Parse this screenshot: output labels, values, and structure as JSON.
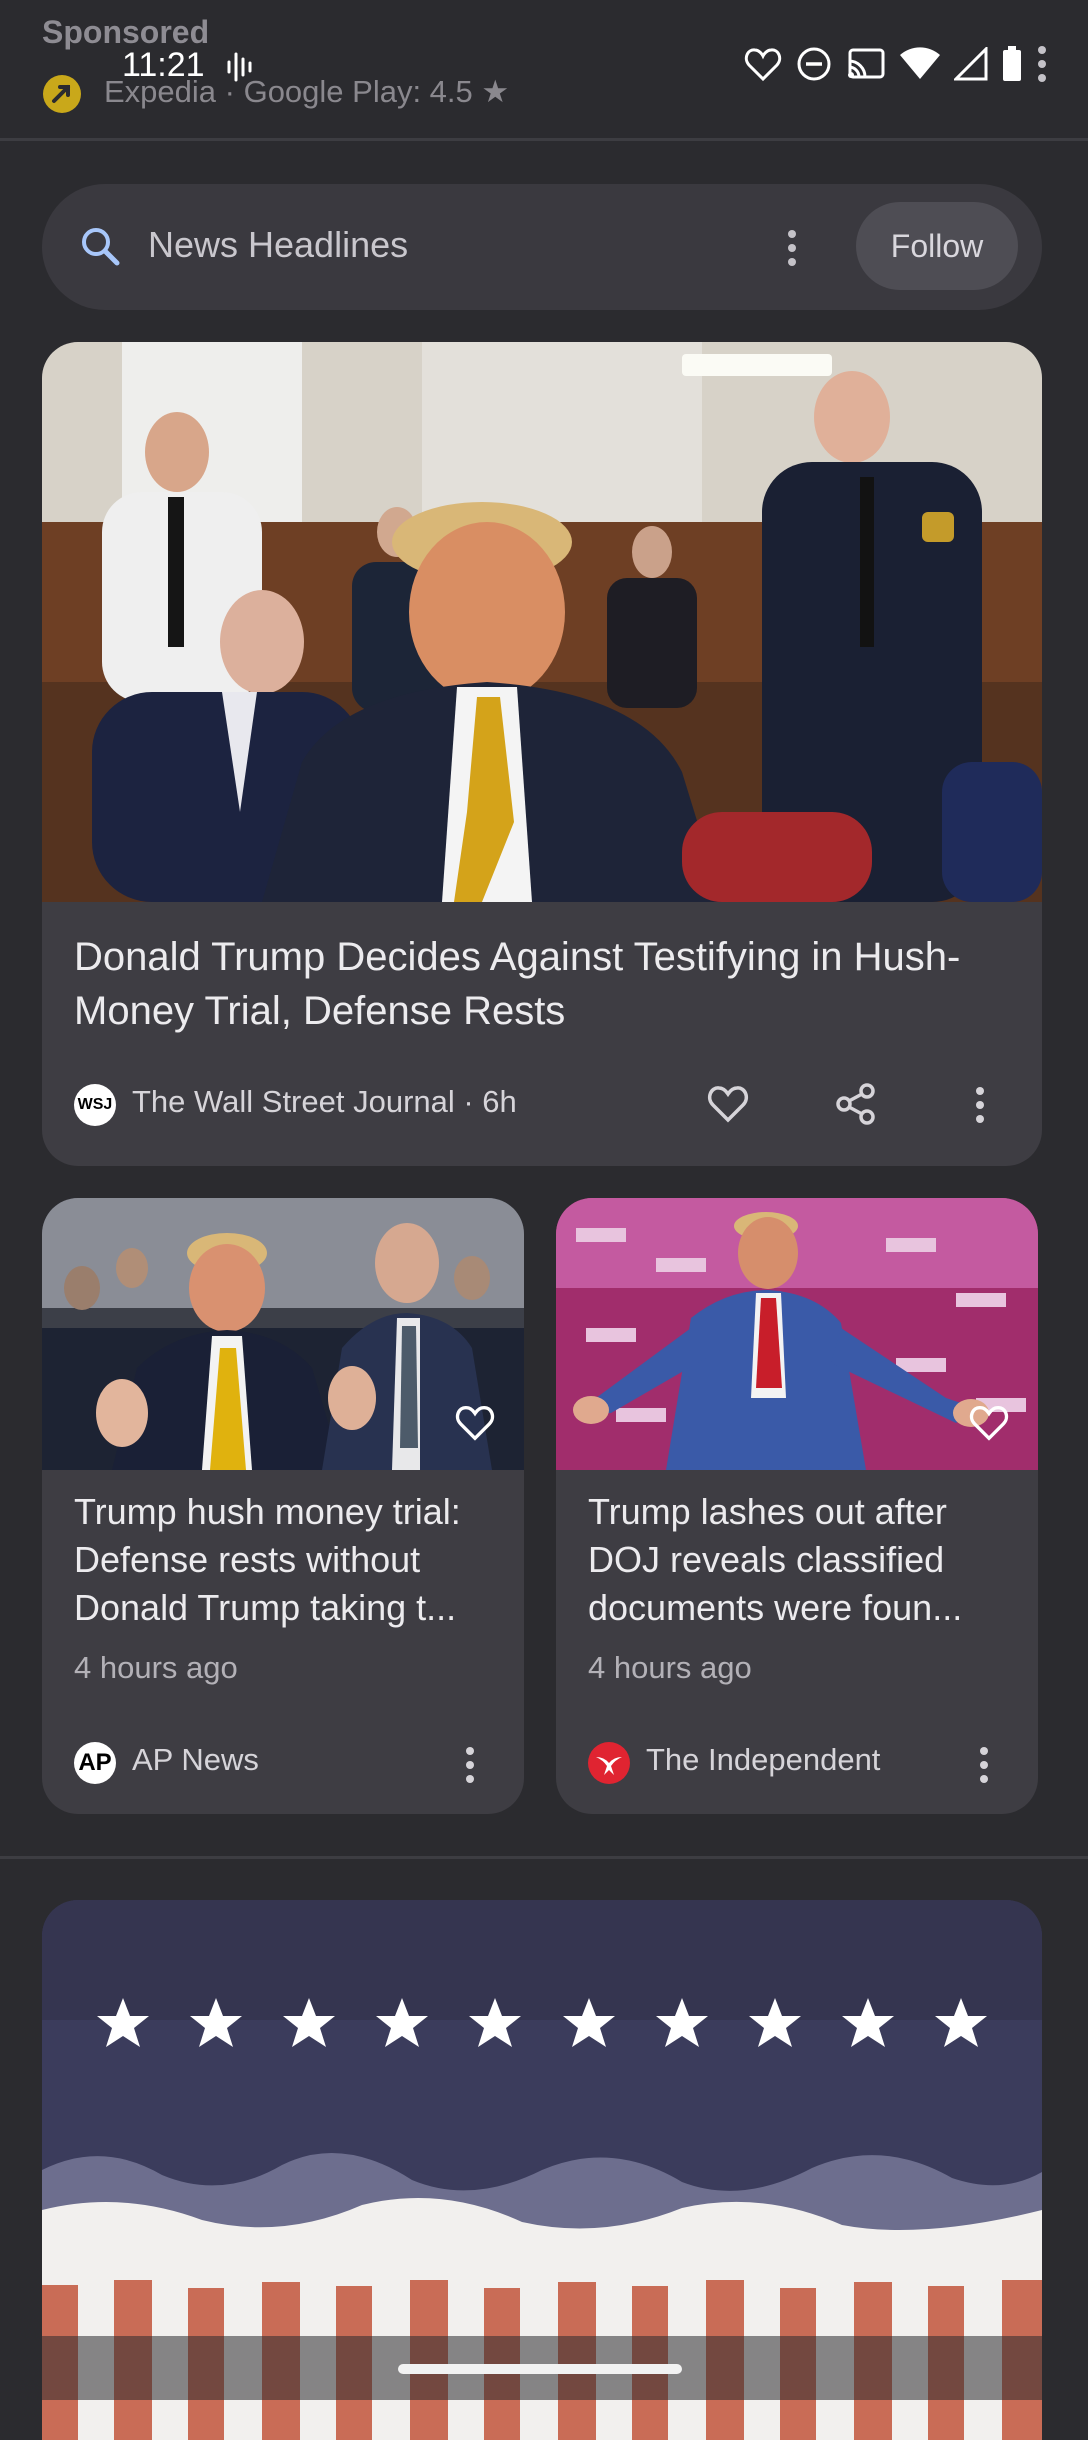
{
  "ad": {
    "sponsored_label": "Sponsored",
    "info": "Expedia · Google Play: 4.5 ★"
  },
  "status_bar": {
    "time": "11:21",
    "icons": [
      "audio-wave-icon",
      "heart-outline-icon",
      "do-not-disturb-icon",
      "cast-icon",
      "wifi-icon",
      "signal-icon",
      "battery-icon",
      "overflow-dots-icon"
    ]
  },
  "search": {
    "title": "News Headlines",
    "follow_label": "Follow"
  },
  "hero_story": {
    "headline": "Donald Trump Decides Against Testifying in Hush-Money Trial, Defense Rests",
    "source": "The Wall Street Journal · 6h",
    "source_logo": "WSJ"
  },
  "stories": [
    {
      "headline": "Trump hush money trial: Defense rests without Donald Trump taking t...",
      "time": "4 hours ago",
      "source": "AP News",
      "source_logo": "AP"
    },
    {
      "headline": "Trump lashes out after DOJ reveals classified documents were foun...",
      "time": "4 hours ago",
      "source": "The Independent",
      "source_logo": "independent-eagle-icon"
    }
  ],
  "colors": {
    "background": "#2b2b2f",
    "card": "#3e3d43",
    "search_pill": "#3a393f",
    "search_icon": "#a8c7fa",
    "follow_button": "#4e4d54"
  }
}
